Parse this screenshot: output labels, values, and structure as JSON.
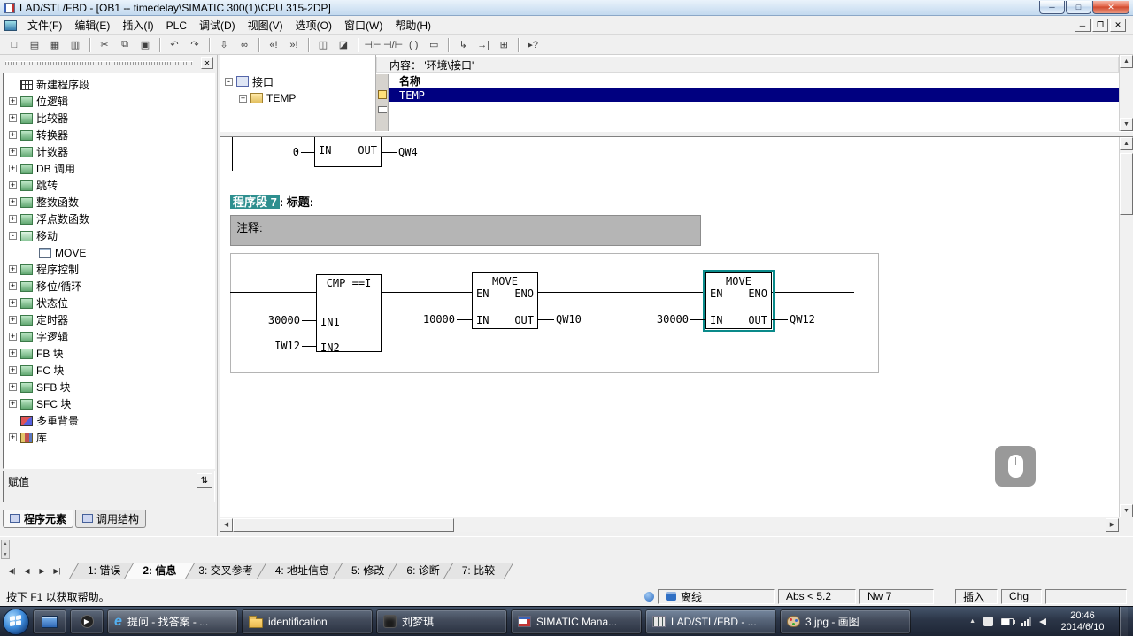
{
  "window": {
    "title": "LAD/STL/FBD  - [OB1 -- timedelay\\SIMATIC 300(1)\\CPU 315-2DP]",
    "menus": [
      {
        "label": "文件(F)"
      },
      {
        "label": "编辑(E)"
      },
      {
        "label": "插入(I)"
      },
      {
        "label": "PLC"
      },
      {
        "label": "调试(D)"
      },
      {
        "label": "视图(V)"
      },
      {
        "label": "选项(O)"
      },
      {
        "label": "窗口(W)"
      },
      {
        "label": "帮助(H)"
      }
    ]
  },
  "icons": {
    "minimize": "─",
    "maximize": "□",
    "close": "✕",
    "mdi_minimize": "─",
    "mdi_restore": "❐",
    "mdi_close": "✕",
    "pane_close": "✕",
    "assign_sort": "⇅",
    "nav_first": "◀|",
    "nav_prev": "◀",
    "nav_next": "▶",
    "nav_last": "▶|",
    "scroll_up": "▲",
    "scroll_down": "▼",
    "scroll_left": "◀",
    "scroll_right": "▶",
    "tray_expand": "▲",
    "play": "▶"
  },
  "toolbar": {
    "buttons": [
      {
        "name": "new",
        "glyph": "□"
      },
      {
        "name": "open",
        "glyph": "▤"
      },
      {
        "name": "save",
        "glyph": "▦"
      },
      {
        "name": "print",
        "glyph": "▥"
      },
      {
        "name": "cut",
        "glyph": "✂"
      },
      {
        "name": "copy",
        "glyph": "⧉"
      },
      {
        "name": "paste",
        "glyph": "▣"
      },
      {
        "name": "undo",
        "glyph": "↶"
      },
      {
        "name": "redo",
        "glyph": "↷"
      },
      {
        "name": "download",
        "glyph": "⇩"
      },
      {
        "name": "monitor",
        "glyph": "∞"
      },
      {
        "name": "prev-error",
        "glyph": "«!"
      },
      {
        "name": "next-error",
        "glyph": "»!"
      },
      {
        "name": "overview",
        "glyph": "◫"
      },
      {
        "name": "details",
        "glyph": "◪"
      },
      {
        "name": "contact-no",
        "glyph": "⊣⊢"
      },
      {
        "name": "contact-nc",
        "glyph": "⊣/⊢"
      },
      {
        "name": "coil",
        "glyph": "( )"
      },
      {
        "name": "empty-box",
        "glyph": "▭"
      },
      {
        "name": "open-branch",
        "glyph": "↳"
      },
      {
        "name": "close-branch",
        "glyph": "→|"
      },
      {
        "name": "new-network",
        "glyph": "⊞"
      },
      {
        "name": "help-cursor",
        "glyph": "▸?"
      }
    ]
  },
  "sidebar": {
    "items": [
      {
        "label": "新建程序段",
        "exp": ""
      },
      {
        "label": "位逻辑",
        "exp": "+"
      },
      {
        "label": "比较器",
        "exp": "+"
      },
      {
        "label": "转换器",
        "exp": "+"
      },
      {
        "label": "计数器",
        "exp": "+"
      },
      {
        "label": "DB 调用",
        "exp": "+"
      },
      {
        "label": "跳转",
        "exp": "+"
      },
      {
        "label": "整数函数",
        "exp": "+"
      },
      {
        "label": "浮点数函数",
        "exp": "+"
      },
      {
        "label": "移动",
        "exp": "-"
      },
      {
        "label": "MOVE",
        "exp": ""
      },
      {
        "label": "程序控制",
        "exp": "+"
      },
      {
        "label": "移位/循环",
        "exp": "+"
      },
      {
        "label": "状态位",
        "exp": "+"
      },
      {
        "label": "定时器",
        "exp": "+"
      },
      {
        "label": "字逻辑",
        "exp": "+"
      },
      {
        "label": "FB 块",
        "exp": "+"
      },
      {
        "label": "FC 块",
        "exp": "+"
      },
      {
        "label": "SFB 块",
        "exp": "+"
      },
      {
        "label": "SFC 块",
        "exp": "+"
      },
      {
        "label": "多重背景",
        "exp": ""
      },
      {
        "label": "库",
        "exp": "+"
      }
    ],
    "assign_label": "赋值",
    "tabs": [
      {
        "label": "程序元素"
      },
      {
        "label": "调用结构"
      }
    ]
  },
  "declaration": {
    "root": "接口",
    "root_exp": "-",
    "child": "TEMP",
    "child_exp": "+",
    "content_header": "内容：  '环境\\接口'",
    "name_header": "名称",
    "row_value": "TEMP"
  },
  "editor": {
    "partial": {
      "in_value": "0",
      "in_pin": "IN",
      "out_pin": "OUT",
      "out_value": "QW4"
    },
    "network": {
      "segment": "程序段 7",
      "rest": ": 标题:"
    },
    "comment_label": "注释:",
    "cmp": {
      "title": "CMP ==I",
      "in1_value": "30000",
      "in1_pin": "IN1",
      "in2_value": "IW12",
      "in2_pin": "IN2"
    },
    "move1": {
      "title": "MOVE",
      "en": "EN",
      "eno": "ENO",
      "in_pin": "IN",
      "out_pin": "OUT",
      "in_value": "10000",
      "out_value": "QW10"
    },
    "move2": {
      "title": "MOVE",
      "en": "EN",
      "eno": "ENO",
      "in_pin": "IN",
      "out_pin": "OUT",
      "in_value": "30000",
      "out_value": "QW12"
    }
  },
  "message_tabs": [
    {
      "label": "1: 错误"
    },
    {
      "label": "2: 信息"
    },
    {
      "label": "3: 交叉参考"
    },
    {
      "label": "4: 地址信息"
    },
    {
      "label": "5: 修改"
    },
    {
      "label": "6: 诊断"
    },
    {
      "label": "7: 比较"
    }
  ],
  "status": {
    "help": "按下 F1 以获取帮助。",
    "offline": "离线",
    "abs": "Abs < 5.2",
    "nw": "Nw 7",
    "insert": "插入",
    "chg": "Chg"
  },
  "taskbar": {
    "buttons": [
      {
        "label": "提问 - 找答案 - ..."
      },
      {
        "label": "identification"
      },
      {
        "label": "刘梦琪"
      },
      {
        "label": "SIMATIC Mana..."
      },
      {
        "label": "LAD/STL/FBD - ..."
      },
      {
        "label": "3.jpg - 画图"
      }
    ],
    "time": "20:46",
    "date": "2014/6/10"
  }
}
